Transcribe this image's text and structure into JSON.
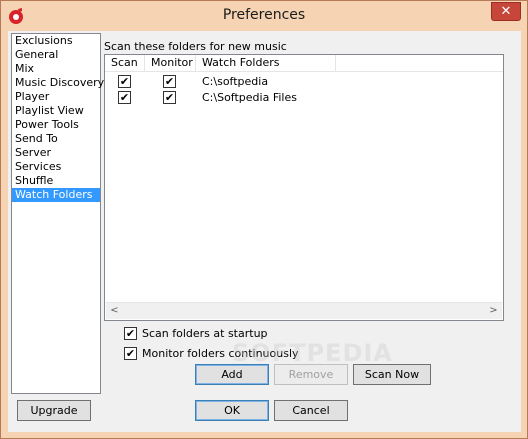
{
  "window": {
    "title": "Preferences",
    "close_glyph": "✕"
  },
  "nav": {
    "items": [
      "Exclusions",
      "General",
      "Mix",
      "Music Discovery",
      "Player",
      "Playlist View",
      "Power Tools",
      "Send To",
      "Server",
      "Services",
      "Shuffle",
      "Watch Folders"
    ],
    "selected": "Watch Folders"
  },
  "section": {
    "label": "Scan these folders for new music"
  },
  "grid": {
    "headers": {
      "scan": "Scan",
      "monitor": "Monitor",
      "folders": "Watch Folders"
    },
    "rows": [
      {
        "scan": true,
        "monitor": true,
        "path": "C:\\softpedia"
      },
      {
        "scan": true,
        "monitor": true,
        "path": "C:\\Softpedia Files"
      }
    ],
    "scroll_left_glyph": "<",
    "scroll_right_glyph": ">"
  },
  "options": {
    "scan_startup": {
      "label": "Scan folders at startup",
      "checked": true
    },
    "monitor_continuous": {
      "label": "Monitor folders continuously",
      "checked": true
    }
  },
  "buttons": {
    "add": "Add",
    "remove": "Remove",
    "scan_now": "Scan Now",
    "upgrade": "Upgrade",
    "ok": "OK",
    "cancel": "Cancel"
  },
  "checkmark_glyph": "✔",
  "watermark": "SOFTPEDIA",
  "colors": {
    "title_bar": "#f5d3b3",
    "close_button": "#c7463a",
    "selection": "#3399ff"
  }
}
